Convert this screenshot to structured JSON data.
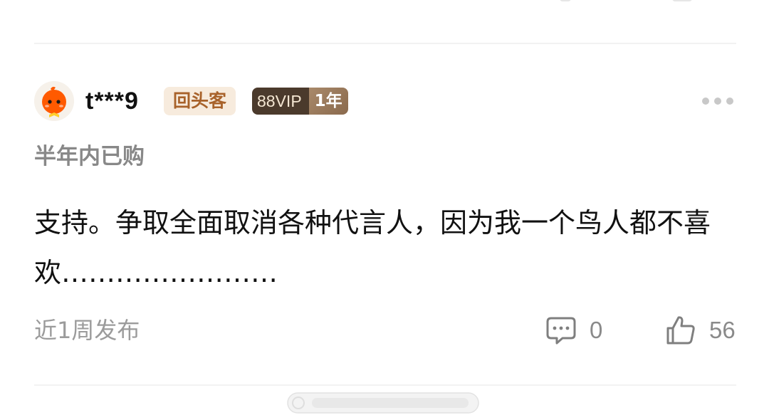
{
  "review": {
    "username": "t***9",
    "badges": {
      "returning_customer": "回头客",
      "vip_label": "88VIP",
      "vip_years": "1年"
    },
    "purchase_tag": "半年内已购",
    "content": "支持。争取全面取消各种代言人，因为我一个鸟人都不喜欢……………………",
    "post_time": "近1周发布",
    "reply_count": "0",
    "like_count": "56"
  },
  "icons": {
    "avatar": "orange-mascot-avatar",
    "more": "more-dots-icon",
    "reply": "comment-bubble-icon",
    "like": "thumbs-up-icon"
  },
  "colors": {
    "returning_badge_bg": "#f7ebdd",
    "returning_badge_text": "#a8622a",
    "vip_bg": "#4b3a2c",
    "avatar_orange": "#ff5a00",
    "muted_text": "#9b9b9b"
  }
}
